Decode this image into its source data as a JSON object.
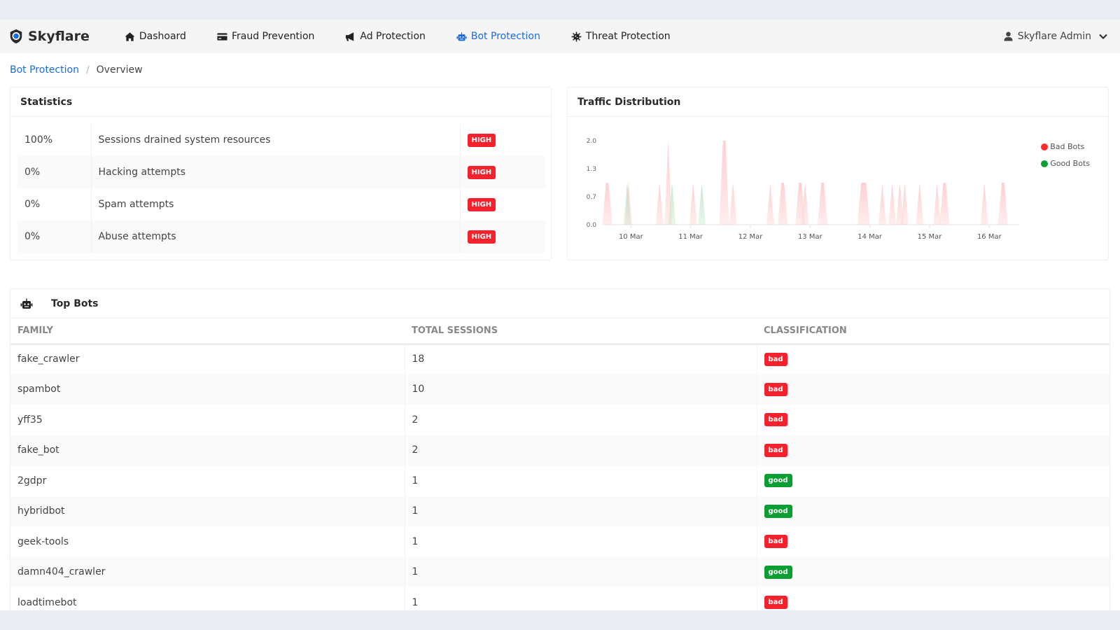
{
  "app": {
    "brand": "Skyflare",
    "nav": [
      {
        "label": "Dashoard",
        "icon": "home-icon",
        "active": false
      },
      {
        "label": "Fraud Prevention",
        "icon": "credit-card-icon",
        "active": false
      },
      {
        "label": "Ad Protection",
        "icon": "megaphone-icon",
        "active": false
      },
      {
        "label": "Bot Protection",
        "icon": "robot-icon",
        "active": true
      },
      {
        "label": "Threat Protection",
        "icon": "virus-icon",
        "active": false
      }
    ],
    "user": {
      "name": "Skyflare Admin",
      "icon": "user-icon"
    }
  },
  "breadcrumb": {
    "parent": "Bot Protection",
    "separator": "/",
    "current": "Overview"
  },
  "statistics": {
    "title": "Statistics",
    "rows": [
      {
        "percent": "100%",
        "label": "Sessions drained system resources",
        "level": "HIGH"
      },
      {
        "percent": "0%",
        "label": "Hacking attempts",
        "level": "HIGH"
      },
      {
        "percent": "0%",
        "label": "Spam attempts",
        "level": "HIGH"
      },
      {
        "percent": "0%",
        "label": "Abuse attempts",
        "level": "HIGH"
      }
    ]
  },
  "traffic": {
    "title": "Traffic Distribution"
  },
  "chart_data": {
    "type": "area",
    "title": "Traffic Distribution",
    "xlabel": "",
    "ylabel": "",
    "x_unit": "hours since 10 Mar 00:00",
    "xlim": [
      -10.5,
      156
    ],
    "ylim": [
      0,
      2.0
    ],
    "yticks": [
      "0.0",
      "0.7",
      "1.3",
      "2.0"
    ],
    "ytick_values": [
      0,
      0.667,
      1.333,
      2.0
    ],
    "xticks": [
      {
        "label": "10 Mar",
        "value": 0
      },
      {
        "label": "11 Mar",
        "value": 24
      },
      {
        "label": "12 Mar",
        "value": 48
      },
      {
        "label": "13 Mar",
        "value": 72
      },
      {
        "label": "14 Mar",
        "value": 96
      },
      {
        "label": "15 Mar",
        "value": 120
      },
      {
        "label": "16 Mar",
        "value": 144
      }
    ],
    "legend": "right",
    "grid": false,
    "series": [
      {
        "name": "Bad Bots",
        "color": "#ff2a2a",
        "fill": "#ffc7c9",
        "spikes": [
          {
            "x": -10,
            "y": 1,
            "w": 1
          },
          {
            "x": -1.0,
            "y": 1
          },
          {
            "x": 11.5,
            "y": 1
          },
          {
            "x": 15.0,
            "y": 2
          },
          {
            "x": 25.0,
            "y": 1
          },
          {
            "x": 37.0,
            "y": 2,
            "w": 1
          },
          {
            "x": 41.0,
            "y": 1
          },
          {
            "x": 56.0,
            "y": 1
          },
          {
            "x": 60.5,
            "y": 1,
            "w": 1
          },
          {
            "x": 67.5,
            "y": 1,
            "w": 1
          },
          {
            "x": 70.0,
            "y": 1
          },
          {
            "x": 76.5,
            "y": 1,
            "w": 1
          },
          {
            "x": 92.5,
            "y": 1,
            "w": 2
          },
          {
            "x": 101.0,
            "y": 1
          },
          {
            "x": 105.0,
            "y": 1
          },
          {
            "x": 108.0,
            "y": 1
          },
          {
            "x": 110.0,
            "y": 1
          },
          {
            "x": 116.0,
            "y": 1
          },
          {
            "x": 123.0,
            "y": 1
          },
          {
            "x": 125.5,
            "y": 1,
            "w": 1
          },
          {
            "x": 142.0,
            "y": 1
          },
          {
            "x": 149.0,
            "y": 1,
            "w": 1
          }
        ]
      },
      {
        "name": "Good Bots",
        "color": "#0a9e33",
        "fill": "#b9e2bf",
        "spikes": [
          {
            "x": -1.5,
            "y": 1
          },
          {
            "x": 16.5,
            "y": 1
          },
          {
            "x": 28.5,
            "y": 1
          }
        ]
      }
    ]
  },
  "top_bots": {
    "title": "Top Bots",
    "columns": [
      "FAMILY",
      "TOTAL SESSIONS",
      "CLASSIFICATION"
    ],
    "rows": [
      {
        "family": "fake_crawler",
        "sessions": "18",
        "classification": "bad"
      },
      {
        "family": "spambot",
        "sessions": "10",
        "classification": "bad"
      },
      {
        "family": "yff35",
        "sessions": "2",
        "classification": "bad"
      },
      {
        "family": "fake_bot",
        "sessions": "2",
        "classification": "bad"
      },
      {
        "family": "2gdpr",
        "sessions": "1",
        "classification": "good"
      },
      {
        "family": "hybridbot",
        "sessions": "1",
        "classification": "good"
      },
      {
        "family": "geek-tools",
        "sessions": "1",
        "classification": "bad"
      },
      {
        "family": "damn404_crawler",
        "sessions": "1",
        "classification": "good"
      },
      {
        "family": "loadtimebot",
        "sessions": "1",
        "classification": "bad"
      }
    ]
  }
}
